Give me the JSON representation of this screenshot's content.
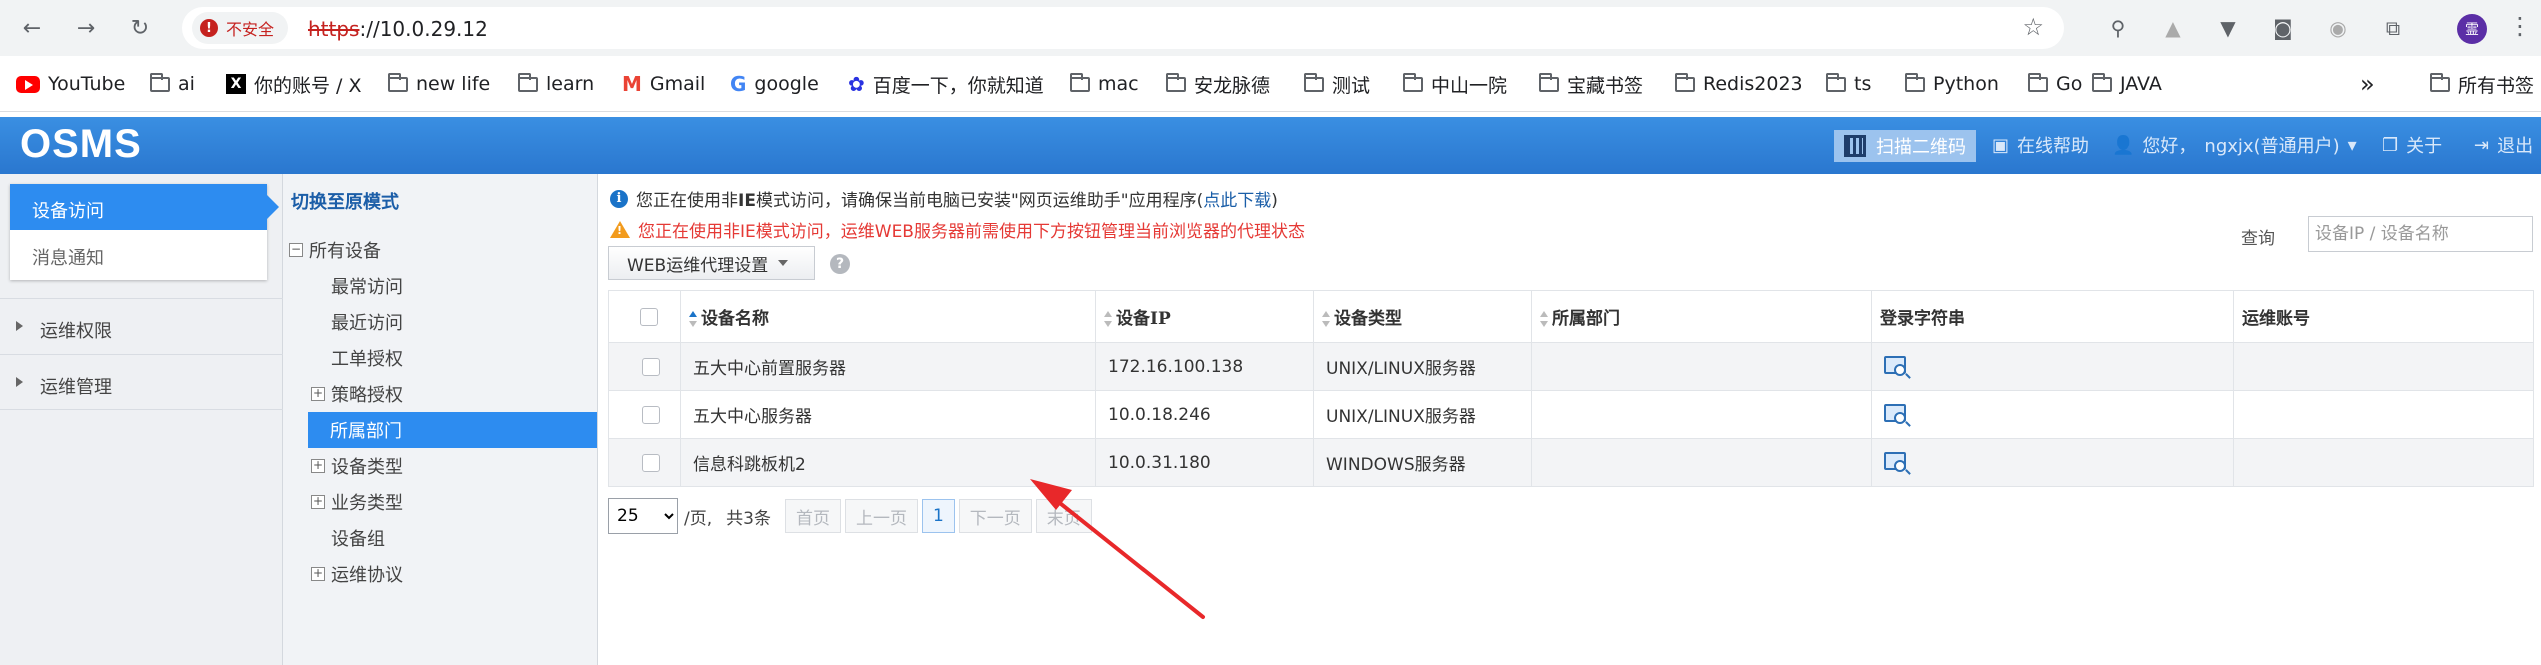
{
  "browser": {
    "security_label": "不安全",
    "url_scheme": "https",
    "url_rest": "://10.0.29.12",
    "profile_initial": "霊"
  },
  "bookmarks": [
    {
      "label": "YouTube",
      "icon": "youtube-icon"
    },
    {
      "label": "ai",
      "icon": "folder-icon"
    },
    {
      "label": "你的账号 / X",
      "icon": "x-icon"
    },
    {
      "label": "new life",
      "icon": "folder-icon"
    },
    {
      "label": "learn",
      "icon": "folder-icon"
    },
    {
      "label": "Gmail",
      "icon": "gmail-icon"
    },
    {
      "label": "google",
      "icon": "google-icon"
    },
    {
      "label": "百度一下，你就知道",
      "icon": "baidu-icon"
    },
    {
      "label": "mac",
      "icon": "folder-icon"
    },
    {
      "label": "安龙脉德",
      "icon": "folder-icon"
    },
    {
      "label": "测试",
      "icon": "folder-icon"
    },
    {
      "label": "中山一院",
      "icon": "folder-icon"
    },
    {
      "label": "宝藏书签",
      "icon": "folder-icon"
    },
    {
      "label": "Redis2023",
      "icon": "folder-icon"
    },
    {
      "label": "ts",
      "icon": "folder-icon"
    },
    {
      "label": "Python",
      "icon": "folder-icon"
    },
    {
      "label": "Go",
      "icon": "folder-icon"
    },
    {
      "label": "JAVA",
      "icon": "folder-icon"
    }
  ],
  "bookmarks_more": "»",
  "bookmarks_all": "所有书签",
  "header": {
    "logo": "OSMS",
    "qr_label": "扫描二维码",
    "help_label": "在线帮助",
    "greeting": "您好，",
    "user": "ngxjx(普通用户)",
    "about": "关于",
    "logout": "退出"
  },
  "left_nav": {
    "active": "设备访问",
    "notice": "消息通知",
    "sections": [
      "运维权限",
      "运维管理"
    ]
  },
  "tree": {
    "switch": "切换至原模式",
    "root": "所有设备",
    "items": [
      {
        "label": "最常访问",
        "expandable": false
      },
      {
        "label": "最近访问",
        "expandable": false
      },
      {
        "label": "工单授权",
        "expandable": false
      },
      {
        "label": "策略授权",
        "expandable": true
      },
      {
        "label": "所属部门",
        "expandable": false,
        "selected": true
      },
      {
        "label": "设备类型",
        "expandable": true
      },
      {
        "label": "业务类型",
        "expandable": true
      },
      {
        "label": "设备组",
        "expandable": false
      },
      {
        "label": "运维协议",
        "expandable": true
      }
    ]
  },
  "notices": {
    "line1_pre": "您正在使用非",
    "line1_ie": "IE",
    "line1_mid": "模式访问，请确保当前电脑已安装\"网页运维助手\"应用程序(",
    "line1_link": "点此下载",
    "line1_post": ")",
    "line2": "您正在使用非IE模式访问，运维WEB服务器前需使用下方按钮管理当前浏览器的代理状态"
  },
  "toolbar": {
    "web_proxy": "WEB运维代理设置",
    "search_label": "查询",
    "search_placeholder": "设备IP / 设备名称"
  },
  "table": {
    "headers": [
      "设备名称",
      "设备IP",
      "设备类型",
      "所属部门",
      "登录字符串",
      "运维账号"
    ],
    "rows": [
      {
        "name": "五大中心前置服务器",
        "ip": "172.16.100.138",
        "type": "UNIX/LINUX服务器",
        "dept": "",
        "account": ""
      },
      {
        "name": "五大中心服务器",
        "ip": "10.0.18.246",
        "type": "UNIX/LINUX服务器",
        "dept": "",
        "account": ""
      },
      {
        "name": "信息科跳板机2",
        "ip": "10.0.31.180",
        "type": "WINDOWS服务器",
        "dept": "",
        "account": ""
      }
    ]
  },
  "pager": {
    "page_size": "25",
    "per_page": "/页,",
    "total": "共3条",
    "first": "首页",
    "prev": "上一页",
    "current": "1",
    "next": "下一页",
    "last": "末页"
  },
  "annotation_color": "#e8282a"
}
